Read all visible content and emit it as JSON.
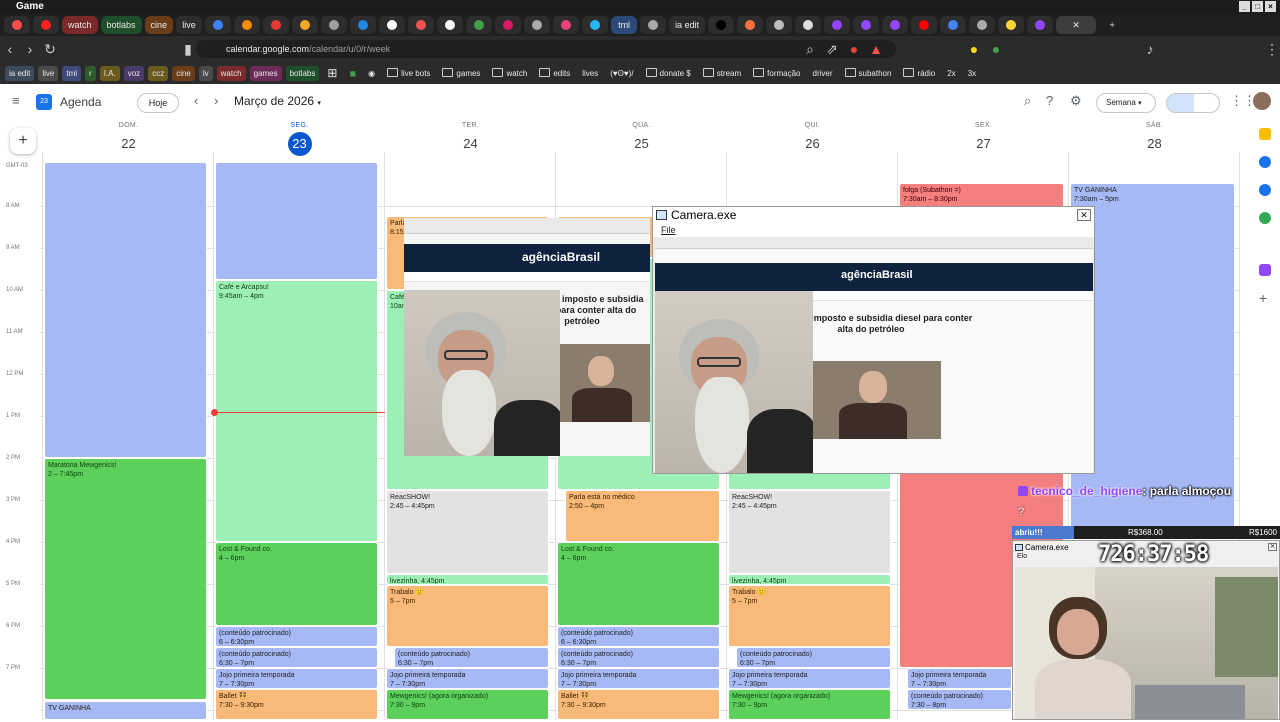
{
  "window": {
    "title": "Game"
  },
  "tabs": [
    {
      "label": "",
      "icon": "app-icon",
      "color": "#ff4d4d"
    },
    {
      "label": "",
      "icon": "record-icon",
      "color": "#ff3b3b"
    },
    {
      "label": "watch",
      "icon": "",
      "color": "#ff5a5a"
    },
    {
      "label": "botlabs",
      "icon": "",
      "color": "#2e7d32"
    },
    {
      "label": "cine",
      "icon": "",
      "color": "#c77d2e"
    },
    {
      "label": "live",
      "icon": "",
      "color": "#555555"
    },
    {
      "label": "tml",
      "icon": "",
      "color": "#4a6fa5"
    },
    {
      "label": "ia edit",
      "icon": "",
      "color": "#3a3a3a"
    }
  ],
  "address": {
    "url_host": "calendar.google.com",
    "url_path": "/calendar/u/0/r/week"
  },
  "bookmarks": [
    "ia edit",
    "live",
    "tml",
    "r",
    "I.A.",
    "voz",
    "ccz",
    "cine",
    "lv",
    "watch",
    "games",
    "botlabs",
    "live bots",
    "games",
    "watch",
    "edits",
    "lives",
    "(♥ʘ♥)/",
    "donate $",
    "stream",
    "formação",
    "driver",
    "subathon",
    "rádio",
    "2x",
    "3x"
  ],
  "calendar": {
    "app_name": "Agenda",
    "today_button": "Hoje",
    "month_label": "Março de 2026",
    "view_label": "Semana",
    "days": [
      {
        "name": "DOM.",
        "num": "22"
      },
      {
        "name": "SEG.",
        "num": "23"
      },
      {
        "name": "TER.",
        "num": "24"
      },
      {
        "name": "QUA.",
        "num": "25"
      },
      {
        "name": "QUI.",
        "num": "26"
      },
      {
        "name": "SEX.",
        "num": "27"
      },
      {
        "name": "SÁB.",
        "num": "28"
      }
    ],
    "timezone": "GMT-03",
    "times": [
      "8 AM",
      "9 AM",
      "10 AM",
      "11 AM",
      "12 PM",
      "1 PM",
      "2 PM",
      "3 PM",
      "4 PM",
      "5 PM",
      "6 PM",
      "7 PM"
    ],
    "events": [
      {
        "title": "Maratona Mewgenics!",
        "time": "2 – 7:45pm"
      },
      {
        "title": "TV GANINHA",
        "time": ""
      },
      {
        "title": "Café e Arcapsu!",
        "time": "9:45am – 4pm"
      },
      {
        "title": "Lost & Found co.",
        "time": "4 – 6pm"
      },
      {
        "title": "(conteúdo patrocinado)",
        "time": "6 – 6:30pm"
      },
      {
        "title": "(conteúdo patrocinado)",
        "time": "6:30 – 7pm"
      },
      {
        "title": "Jojo primeira temporada",
        "time": "7 – 7:30pm"
      },
      {
        "title": "Ballet 👯",
        "time": "7:30 – 9:30pm"
      },
      {
        "title": "Parla",
        "time": "8:15"
      },
      {
        "title": "Café",
        "time": "10am"
      },
      {
        "title": "ReacSHOW!",
        "time": "2:45 – 4:45pm"
      },
      {
        "title": "livezinha, 4:45pm",
        "time": ""
      },
      {
        "title": "Trabalo 🙂",
        "time": "5 – 7pm"
      },
      {
        "title": "(conteúdo patrocinado)",
        "time": "6:30 – 7pm"
      },
      {
        "title": "Jojo primeira temporada",
        "time": "7 – 7:30pm"
      },
      {
        "title": "Mewgenics! (agora organizado)",
        "time": "7:30 – 9pm"
      },
      {
        "title": "Parla está no médico",
        "time": "2:50 – 4pm"
      },
      {
        "title": "Lost & Found co.",
        "time": "4 – 6pm"
      },
      {
        "title": "(conteúdo patrocinado)",
        "time": "6 – 6:30pm"
      },
      {
        "title": "(conteúdo patrocinado)",
        "time": "6:30 – 7pm"
      },
      {
        "title": "Jojo primeira temporada",
        "time": "7 – 7:30pm"
      },
      {
        "title": "Ballet 👯",
        "time": "7:30 – 9:30pm"
      },
      {
        "title": "ReacSHOW!",
        "time": "2:45 – 4:45pm"
      },
      {
        "title": "livezinha, 4:45pm",
        "time": ""
      },
      {
        "title": "Trabalo 🙂",
        "time": "5 – 7pm"
      },
      {
        "title": "(conteúdo patrocinado)",
        "time": "6:30 – 7pm"
      },
      {
        "title": "Jojo primeira temporada",
        "time": "7 – 7:30pm"
      },
      {
        "title": "Mewgenics! (agora organizado)",
        "time": "7:30 – 9pm"
      },
      {
        "title": "folga (Subathon =)",
        "time": "7:30am – 8:30pm"
      },
      {
        "title": "Jojo primeira temporada",
        "time": "7 – 7:30pm"
      },
      {
        "title": "(conteúdo patrocinado)",
        "time": "7:30 – 8pm"
      },
      {
        "title": "TV GANINHA",
        "time": "7:30am – 5pm"
      }
    ]
  },
  "camera_window": {
    "title": "Camera.exe",
    "menu": "File"
  },
  "article": {
    "site": "agênciaBrasil",
    "headline": "Lula zera imposto e subsidia diesel para conter alta do petróleo",
    "headline_left": "Lula zera imposto e subsidia diesel para conter alta do petróleo"
  },
  "chat": {
    "user": "tecnico_de_higiene",
    "message": ": parla almoçou",
    "extra": "?"
  },
  "subgoal": {
    "label": "abriu!!!",
    "current": "R$368.00",
    "goal": "R$1600",
    "progress": 0.23
  },
  "camera2": {
    "title": "Camera.exe",
    "menu": "Elo",
    "timer": "726:37:58"
  }
}
